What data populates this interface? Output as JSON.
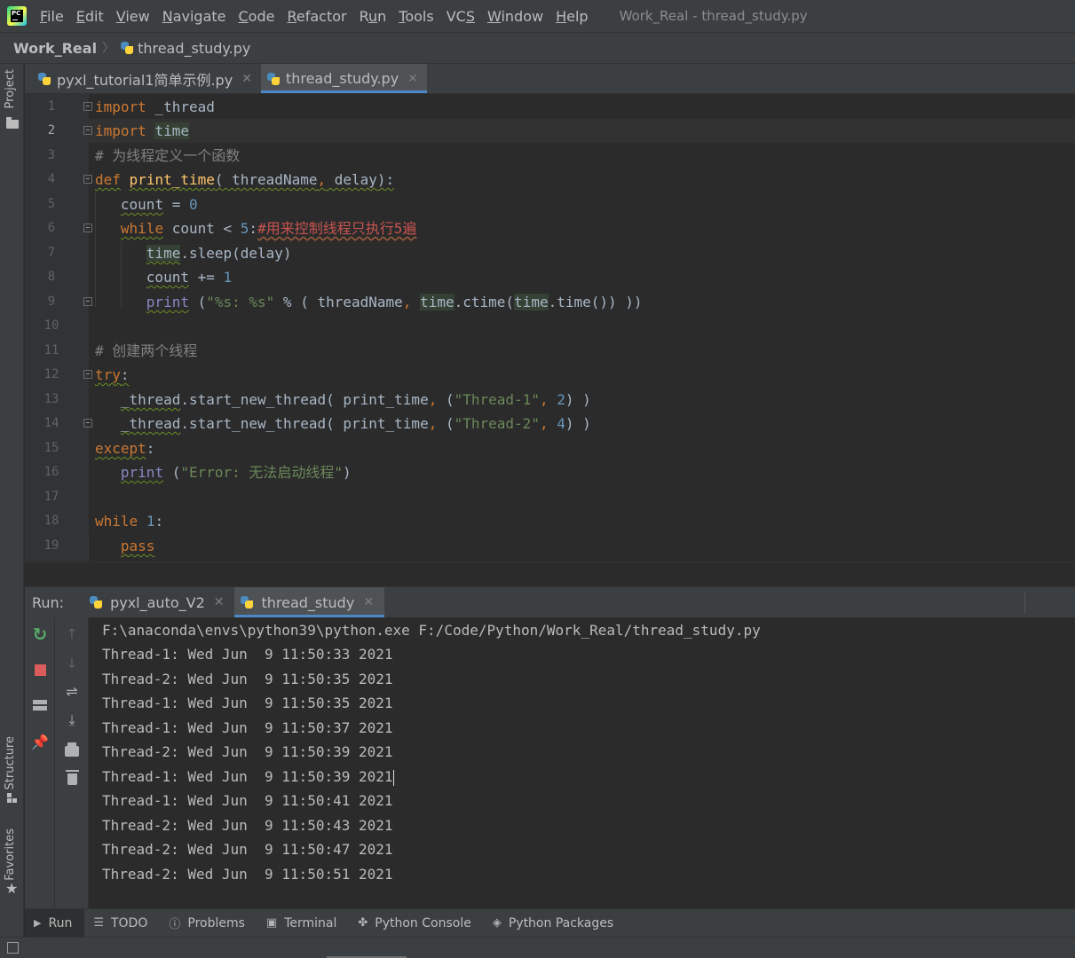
{
  "window": {
    "title": "Work_Real - thread_study.py",
    "menu": [
      {
        "pre": "",
        "u": "F",
        "post": "ile"
      },
      {
        "pre": "",
        "u": "E",
        "post": "dit"
      },
      {
        "pre": "",
        "u": "V",
        "post": "iew"
      },
      {
        "pre": "",
        "u": "N",
        "post": "avigate"
      },
      {
        "pre": "",
        "u": "C",
        "post": "ode"
      },
      {
        "pre": "",
        "u": "R",
        "post": "efactor"
      },
      {
        "pre": "R",
        "u": "u",
        "post": "n"
      },
      {
        "pre": "",
        "u": "T",
        "post": "ools"
      },
      {
        "pre": "VC",
        "u": "S",
        "post": ""
      },
      {
        "pre": "",
        "u": "W",
        "post": "indow"
      },
      {
        "pre": "",
        "u": "H",
        "post": "elp"
      }
    ],
    "logo_text": "PC"
  },
  "breadcrumb": {
    "project": "Work_Real",
    "file": "thread_study.py"
  },
  "left_strip": {
    "project": "Project",
    "structure": "Structure",
    "favorites": "Favorites"
  },
  "editor_tabs": [
    {
      "label": "pyxl_tutorial1简单示例.py",
      "active": false
    },
    {
      "label": "thread_study.py",
      "active": true
    }
  ],
  "editor": {
    "current_line": 2,
    "line_numbers": [
      "1",
      "2",
      "3",
      "4",
      "5",
      "6",
      "7",
      "8",
      "9",
      "10",
      "11",
      "12",
      "13",
      "14",
      "15",
      "16",
      "17",
      "18",
      "19"
    ],
    "code": {
      "l1_kw": "import",
      "l1_rest": " _thread",
      "l2_kw": "import",
      "l2_sp": " ",
      "l2_mod": "time",
      "l3": "# 为线程定义一个函数",
      "l4_kw": "def",
      "l4_sp": " ",
      "l4_fn": "print_time",
      "l4_p1": "( threadName",
      "l4_comma": ",",
      "l4_p2": " delay",
      "l4_end": "):",
      "l5_ind": "   ",
      "l5_var": "count",
      "l5_op": " = ",
      "l5_num": "0",
      "l6_ind": "   ",
      "l6_kw": "while",
      "l6_mid": " count < ",
      "l6_num": "5",
      "l6_colon": ":",
      "l6_cmt": "#用来控制线程只执行5遍",
      "l7_ind": "      ",
      "l7_mod": "time",
      "l7_rest": ".sleep(delay)",
      "l8_ind": "      ",
      "l8_var": "count",
      "l8_op": " += ",
      "l8_num": "1",
      "l9_ind": "      ",
      "l9_bi": "print",
      "l9_sp": " (",
      "l9_str": "\"%s: %s\"",
      "l9_mid": " % ( threadName",
      "l9_comma": ",",
      "l9_sp2": " ",
      "l9_t1": "time",
      "l9_ctime": ".ctime(",
      "l9_t2": "time",
      "l9_end": ".time()) ))",
      "l11": "# 创建两个线程",
      "l12_kw": "try",
      "l12_colon": ":",
      "l13_ind": "   ",
      "l13_mod": "_thread",
      "l13_call": ".start_new_thread( print_time",
      "l13_comma": ",",
      "l13_sp": " (",
      "l13_str": "\"Thread-1\"",
      "l13_comma2": ",",
      "l13_sp2": " ",
      "l13_num": "2",
      "l13_end": ") )",
      "l14_ind": "   ",
      "l14_mod": "_thread",
      "l14_call": ".start_new_thread( print_time",
      "l14_comma": ",",
      "l14_sp": " (",
      "l14_str": "\"Thread-2\"",
      "l14_comma2": ",",
      "l14_sp2": " ",
      "l14_num": "4",
      "l14_end": ") )",
      "l15_kw": "except",
      "l15_colon": ":",
      "l16_ind": "   ",
      "l16_bi": "print",
      "l16_sp": " (",
      "l16_str": "\"Error: 无法启动线程\"",
      "l16_end": ")",
      "l18_kw": "while",
      "l18_sp": " ",
      "l18_num": "1",
      "l18_colon": ":",
      "l19_ind": "   ",
      "l19_kw": "pass"
    }
  },
  "run_panel": {
    "label": "Run:",
    "tabs": [
      {
        "label": "pyxl_auto_V2",
        "active": false
      },
      {
        "label": "thread_study",
        "active": true
      }
    ],
    "console": [
      "F:\\anaconda\\envs\\python39\\python.exe F:/Code/Python/Work_Real/thread_study.py",
      "Thread-1: Wed Jun  9 11:50:33 2021",
      "Thread-2: Wed Jun  9 11:50:35 2021",
      "Thread-1: Wed Jun  9 11:50:35 2021",
      "Thread-1: Wed Jun  9 11:50:37 2021",
      "Thread-2: Wed Jun  9 11:50:39 2021",
      "Thread-1: Wed Jun  9 11:50:39 2021",
      "Thread-1: Wed Jun  9 11:50:41 2021",
      "Thread-2: Wed Jun  9 11:50:43 2021",
      "Thread-2: Wed Jun  9 11:50:47 2021",
      "Thread-2: Wed Jun  9 11:50:51 2021"
    ]
  },
  "tool_windows": [
    {
      "label": "Run",
      "icon": "run-icon",
      "active": true
    },
    {
      "label": "TODO",
      "icon": "todo-icon",
      "active": false
    },
    {
      "label": "Problems",
      "icon": "problems-icon",
      "active": false
    },
    {
      "label": "Terminal",
      "icon": "terminal-icon",
      "active": false
    },
    {
      "label": "Python Console",
      "icon": "python-console-icon",
      "active": false
    },
    {
      "label": "Python Packages",
      "icon": "python-packages-icon",
      "active": false
    }
  ],
  "colors": {
    "background": "#2b2b2b",
    "chrome": "#3c3f41",
    "keyword": "#cc7832",
    "number": "#6897bb",
    "string": "#6a8759",
    "comment": "#808080",
    "accent": "#4a88c7"
  }
}
